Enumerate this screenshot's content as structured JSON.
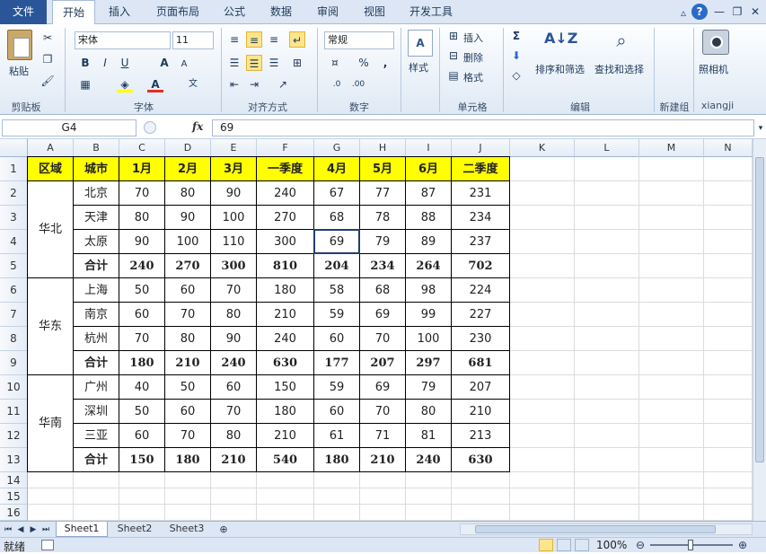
{
  "tabs": [
    "文件",
    "开始",
    "插入",
    "页面布局",
    "公式",
    "数据",
    "审阅",
    "视图",
    "开发工具"
  ],
  "window_controls": [
    "▵",
    "?",
    "—",
    "❐",
    "✕"
  ],
  "ribbon": {
    "paste": "粘贴",
    "font_name": "宋体",
    "font_size": "11",
    "number_format": "常规",
    "style": "样式",
    "insert": "插入",
    "delete": "删除",
    "format": "格式",
    "sort_filter": "排序和筛选",
    "find_select": "查找和选择",
    "camera": "照相机",
    "groups": {
      "clipboard": "剪贴板",
      "font": "字体",
      "alignment": "对齐方式",
      "number": "数字",
      "cells": "单元格",
      "editing": "编辑",
      "new_group": "新建组",
      "xiangji": "xiangji"
    }
  },
  "formula_bar": {
    "name_box": "G4",
    "fx": "fx",
    "value": "69"
  },
  "columns": [
    "A",
    "B",
    "C",
    "D",
    "E",
    "F",
    "G",
    "H",
    "I",
    "J",
    "K",
    "L",
    "M",
    "N"
  ],
  "rows": [
    "1",
    "2",
    "3",
    "4",
    "5",
    "6",
    "7",
    "8",
    "9",
    "10",
    "11",
    "12",
    "13",
    "14",
    "15",
    "16"
  ],
  "table": {
    "header": [
      "区域",
      "城市",
      "1月",
      "2月",
      "3月",
      "一季度",
      "4月",
      "5月",
      "6月",
      "二季度"
    ],
    "regions": [
      {
        "name": "华北",
        "rows": [
          [
            "北京",
            "70",
            "80",
            "90",
            "240",
            "67",
            "77",
            "87",
            "231"
          ],
          [
            "天津",
            "80",
            "90",
            "100",
            "270",
            "68",
            "78",
            "88",
            "234"
          ],
          [
            "太原",
            "90",
            "100",
            "110",
            "300",
            "69",
            "79",
            "89",
            "237"
          ],
          [
            "合计",
            "240",
            "270",
            "300",
            "810",
            "204",
            "234",
            "264",
            "702"
          ]
        ]
      },
      {
        "name": "华东",
        "rows": [
          [
            "上海",
            "50",
            "60",
            "70",
            "180",
            "58",
            "68",
            "98",
            "224"
          ],
          [
            "南京",
            "60",
            "70",
            "80",
            "210",
            "59",
            "69",
            "99",
            "227"
          ],
          [
            "杭州",
            "70",
            "80",
            "90",
            "240",
            "60",
            "70",
            "100",
            "230"
          ],
          [
            "合计",
            "180",
            "210",
            "240",
            "630",
            "177",
            "207",
            "297",
            "681"
          ]
        ]
      },
      {
        "name": "华南",
        "rows": [
          [
            "广州",
            "40",
            "50",
            "60",
            "150",
            "59",
            "69",
            "79",
            "207"
          ],
          [
            "深圳",
            "50",
            "60",
            "70",
            "180",
            "60",
            "70",
            "80",
            "210"
          ],
          [
            "三亚",
            "60",
            "70",
            "80",
            "210",
            "61",
            "71",
            "81",
            "213"
          ],
          [
            "合计",
            "150",
            "180",
            "210",
            "540",
            "180",
            "210",
            "240",
            "630"
          ]
        ]
      }
    ]
  },
  "sheets": [
    "Sheet1",
    "Sheet2",
    "Sheet3"
  ],
  "status": {
    "ready": "就绪",
    "zoom": "100%"
  }
}
